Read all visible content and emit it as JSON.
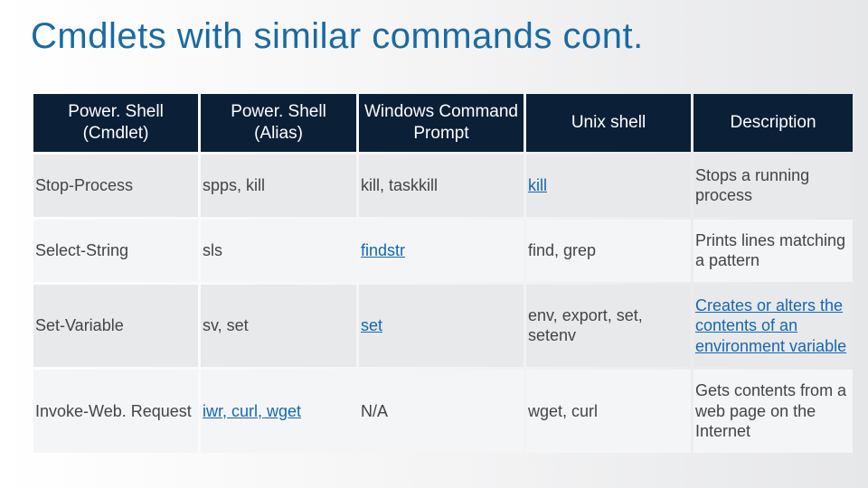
{
  "title": "Cmdlets with similar commands cont.",
  "headers": {
    "c1": "Power. Shell (Cmdlet)",
    "c2": "Power. Shell (Alias)",
    "c3": "Windows Command Prompt",
    "c4": "Unix shell",
    "c5": "Description"
  },
  "rows": [
    {
      "cmdlet": "Stop-Process",
      "alias_plain": "spps, kill",
      "cmd_plain": "kill, taskkill",
      "unix_link": "kill",
      "desc": "Stops a running process"
    },
    {
      "cmdlet": "Select-String",
      "alias_plain": "sls",
      "cmd_link": "findstr",
      "unix_plain": "find, grep",
      "desc": "Prints lines matching a pattern"
    },
    {
      "cmdlet": "Set-Variable",
      "alias_plain": "sv, set",
      "cmd_link": "set",
      "unix_plain": "env, export, set, setenv",
      "desc_link1": "Creates or alters the contents of an environment variable"
    },
    {
      "cmdlet": "Invoke-Web. Request",
      "alias_link": "iwr, curl, wget",
      "cmd_plain": "N/A",
      "unix_plain": "wget, curl",
      "desc": "Gets contents from a web page on the Internet"
    }
  ]
}
